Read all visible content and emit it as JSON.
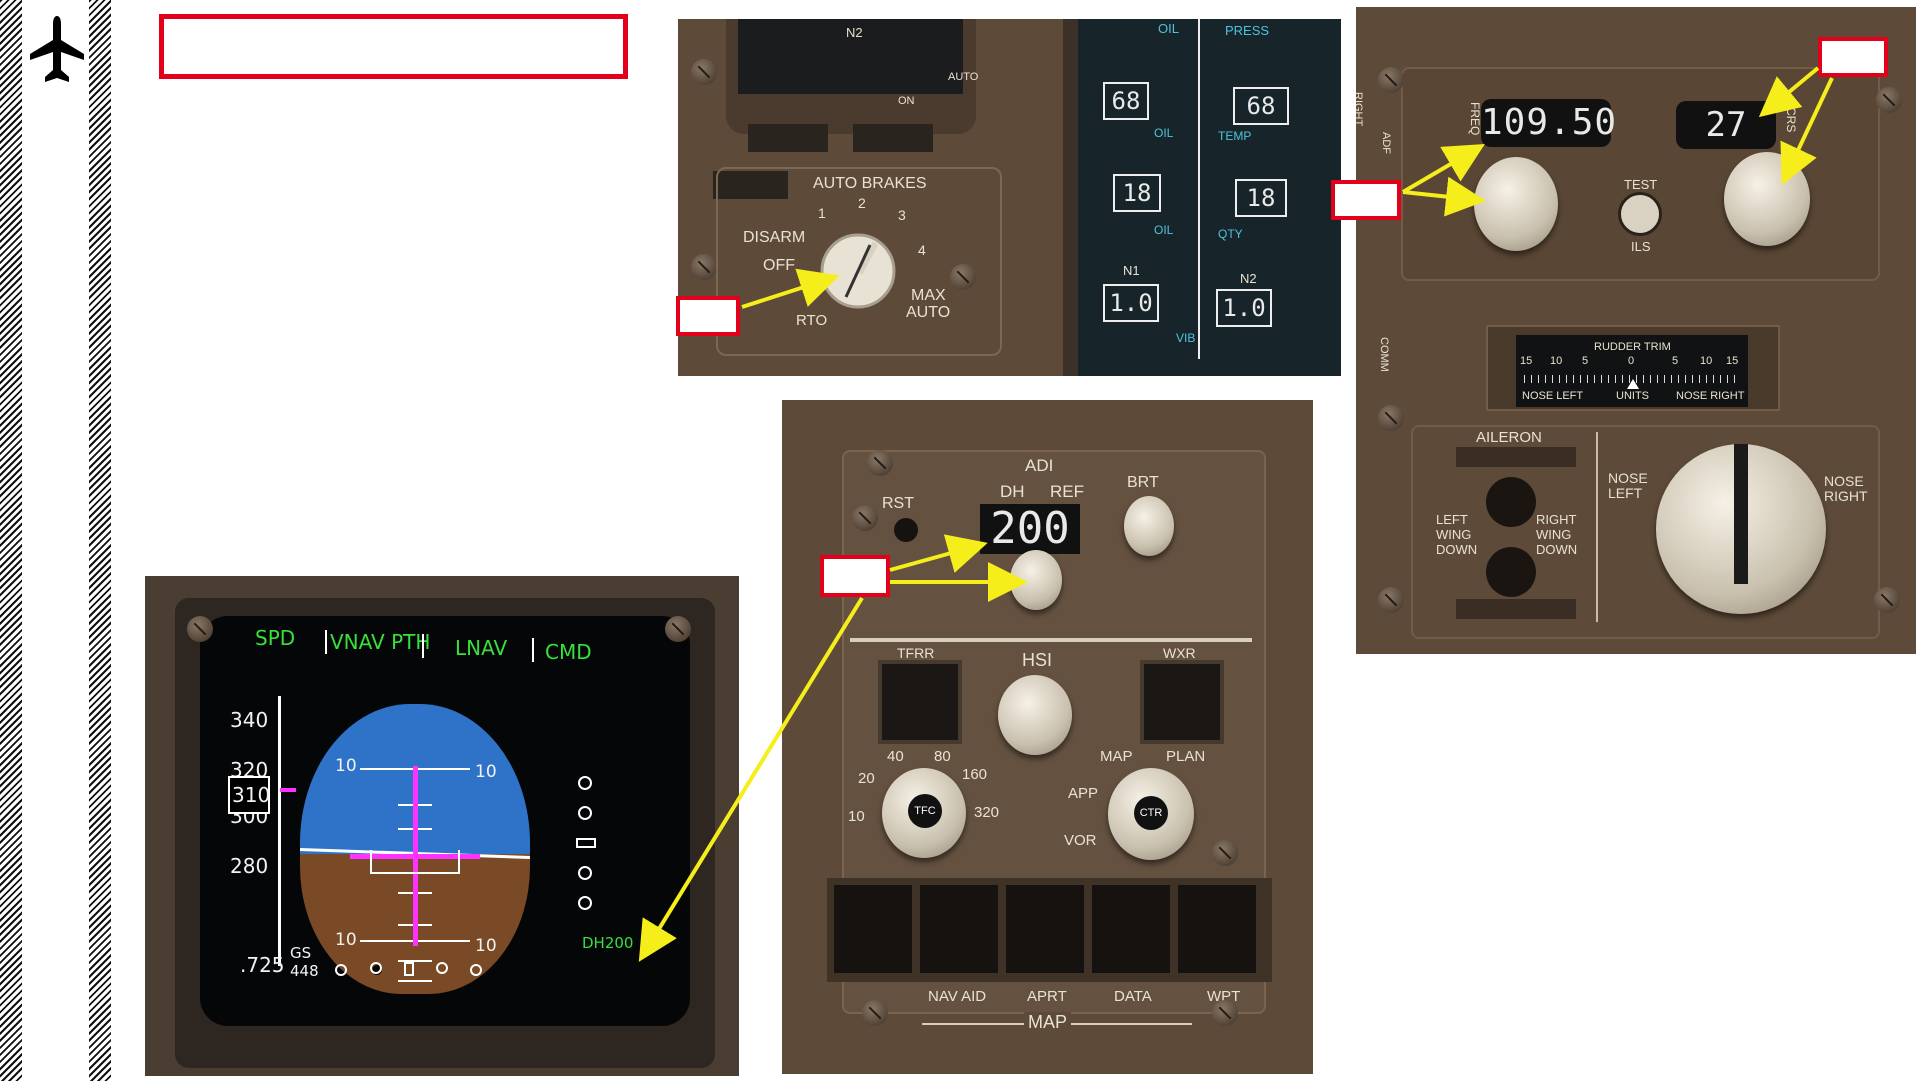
{
  "autobrakes": {
    "title": "AUTO BRAKES",
    "disarm": "DISARM",
    "off": "OFF",
    "rto": "RTO",
    "max_auto": [
      "MAX",
      "AUTO"
    ],
    "positions": [
      "1",
      "2",
      "3",
      "4"
    ],
    "n2_label": "N2",
    "auto": "AUTO",
    "on": "ON"
  },
  "eicas": {
    "oil": "OIL",
    "press": "PRESS",
    "temp": "TEMP",
    "qty": "QTY",
    "vib": "VIB",
    "n1": "N1",
    "n2": "N2",
    "temp_left": "68",
    "temp_right": "68",
    "qty_left": "18",
    "qty_right": "18",
    "vib_left": "1.0",
    "vib_right": "1.0"
  },
  "ils_panel": {
    "freq_label": "FREQ",
    "crs_label": "CRS",
    "freq_value": "109.50",
    "crs_value": "27",
    "test_label": "TEST",
    "ils_label": "ILS",
    "side_label_1": "RIGHT",
    "side_label_2": "ADF",
    "comm_label": "COMM",
    "rudder_trim": {
      "title": "RUDDER TRIM",
      "scale": [
        "15",
        "10",
        "5",
        "0",
        "5",
        "10",
        "15"
      ],
      "nose_left": "NOSE LEFT",
      "units": "UNITS",
      "nose_right": "NOSE RIGHT"
    },
    "aileron": "AILERON",
    "left_wing_down": [
      "LEFT",
      "WING",
      "DOWN"
    ],
    "right_wing_down": [
      "RIGHT",
      "WING",
      "DOWN"
    ],
    "nose_left": [
      "NOSE",
      "LEFT"
    ],
    "nose_right": [
      "NOSE",
      "RIGHT"
    ]
  },
  "efis": {
    "adi": "ADI",
    "dh": "DH",
    "ref": "REF",
    "rst": "RST",
    "brt": "BRT",
    "dh_value": "200",
    "tfrr": "TFRR",
    "hsi": "HSI",
    "wxr": "WXR",
    "range": [
      "10",
      "20",
      "40",
      "80",
      "160",
      "320"
    ],
    "tfc": "TFC",
    "modes": [
      "APP",
      "VOR",
      "MAP",
      "PLAN"
    ],
    "ctr": "CTR",
    "buttons": [
      "NAV AID",
      "APRT",
      "DATA",
      "WPT"
    ],
    "map": "MAP"
  },
  "pfd": {
    "fma": [
      "SPD",
      "VNAV PTH",
      "LNAV",
      "CMD"
    ],
    "speeds": [
      "340",
      "320",
      "300",
      "280"
    ],
    "current_speed": "310",
    "mach": ".725",
    "gs_label": "GS",
    "gs_value": "448",
    "pitch": [
      "10",
      "10",
      "10",
      "10"
    ],
    "dh_readout": "DH200"
  },
  "colors": {
    "callout_red": "#e3001b",
    "arrow_yellow": "#f5ee1a",
    "pfd_green": "#37e03b",
    "pfd_magenta": "#ff33ff",
    "sky": "#2f73c9",
    "ground": "#7a4a26",
    "panel_brown": "#5e4a38"
  },
  "icons": [
    "airplane-icon"
  ]
}
